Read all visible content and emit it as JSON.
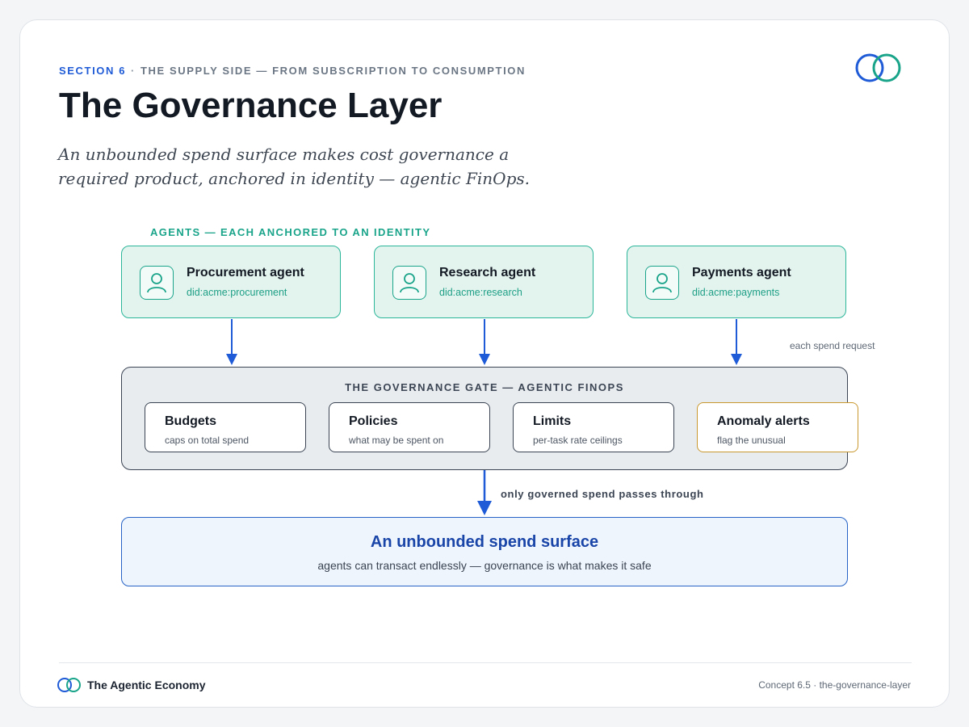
{
  "header": {
    "section": "SECTION 6",
    "separator": "·",
    "section_topic": "THE SUPPLY SIDE — FROM SUBSCRIPTION TO CONSUMPTION",
    "title": "The Governance Layer",
    "subtitle": "An unbounded spend surface makes cost governance a required product, anchored in identity — agentic FinOps."
  },
  "agents": {
    "label": "AGENTS — EACH ANCHORED TO AN IDENTITY",
    "items": [
      {
        "name": "Procurement agent",
        "did": "did:acme:procurement",
        "icon": "user-icon"
      },
      {
        "name": "Research agent",
        "did": "did:acme:research",
        "icon": "user-icon"
      },
      {
        "name": "Payments agent",
        "did": "did:acme:payments",
        "icon": "user-icon"
      }
    ],
    "request_label": "each spend request"
  },
  "gate": {
    "title": "THE GOVERNANCE GATE — AGENTIC FINOPS",
    "controls": [
      {
        "name": "Budgets",
        "desc": "caps on total spend"
      },
      {
        "name": "Policies",
        "desc": "what may be spent on"
      },
      {
        "name": "Limits",
        "desc": "per-task rate ceilings"
      },
      {
        "name": "Anomaly alerts",
        "desc": "flag the unusual"
      }
    ],
    "pass_label": "only governed spend passes through"
  },
  "surface": {
    "title": "An unbounded spend surface",
    "desc": "agents can transact endlessly — governance is what makes it safe"
  },
  "footer": {
    "brand": "The Agentic Economy",
    "concept": "Concept 6.5 · the-governance-layer"
  },
  "colors": {
    "accent_blue": "#1f5bd6",
    "agent_green": "#1aa48a",
    "agent_fill": "#e3f4ee",
    "gate_border": "#3a4453",
    "alert_border": "#c9982e",
    "surface_title": "#1a45a8"
  }
}
